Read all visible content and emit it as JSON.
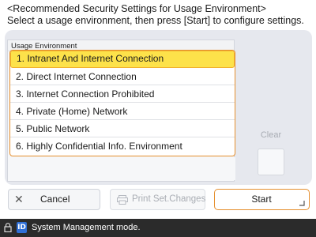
{
  "header": {
    "title": "<Recommended Security Settings for Usage Environment>",
    "instruction": "Select a usage environment, then press [Start] to configure settings."
  },
  "list": {
    "caption": "Usage Environment",
    "selected_index": 0,
    "options": [
      "1. Intranet And Internet Connection",
      "2. Direct Internet Connection",
      "3. Internet Connection Prohibited",
      "4. Private (Home) Network",
      "5. Public Network",
      "6. Highly Confidential Info. Environment"
    ]
  },
  "side": {
    "clear_label": "Clear"
  },
  "footer": {
    "cancel_label": "Cancel",
    "print_label": "Print Set.Changes",
    "start_label": "Start"
  },
  "status_bar": {
    "badge": "ID",
    "text": "System Management mode."
  },
  "colors": {
    "selection_fill": "#fde24a",
    "accent_border": "#e58f2e",
    "status_bar_bg": "#2b2b2b",
    "id_badge": "#2f6fd6"
  },
  "icons": [
    "close-icon",
    "print-icon",
    "enter-corner-icon",
    "lock-icon"
  ]
}
